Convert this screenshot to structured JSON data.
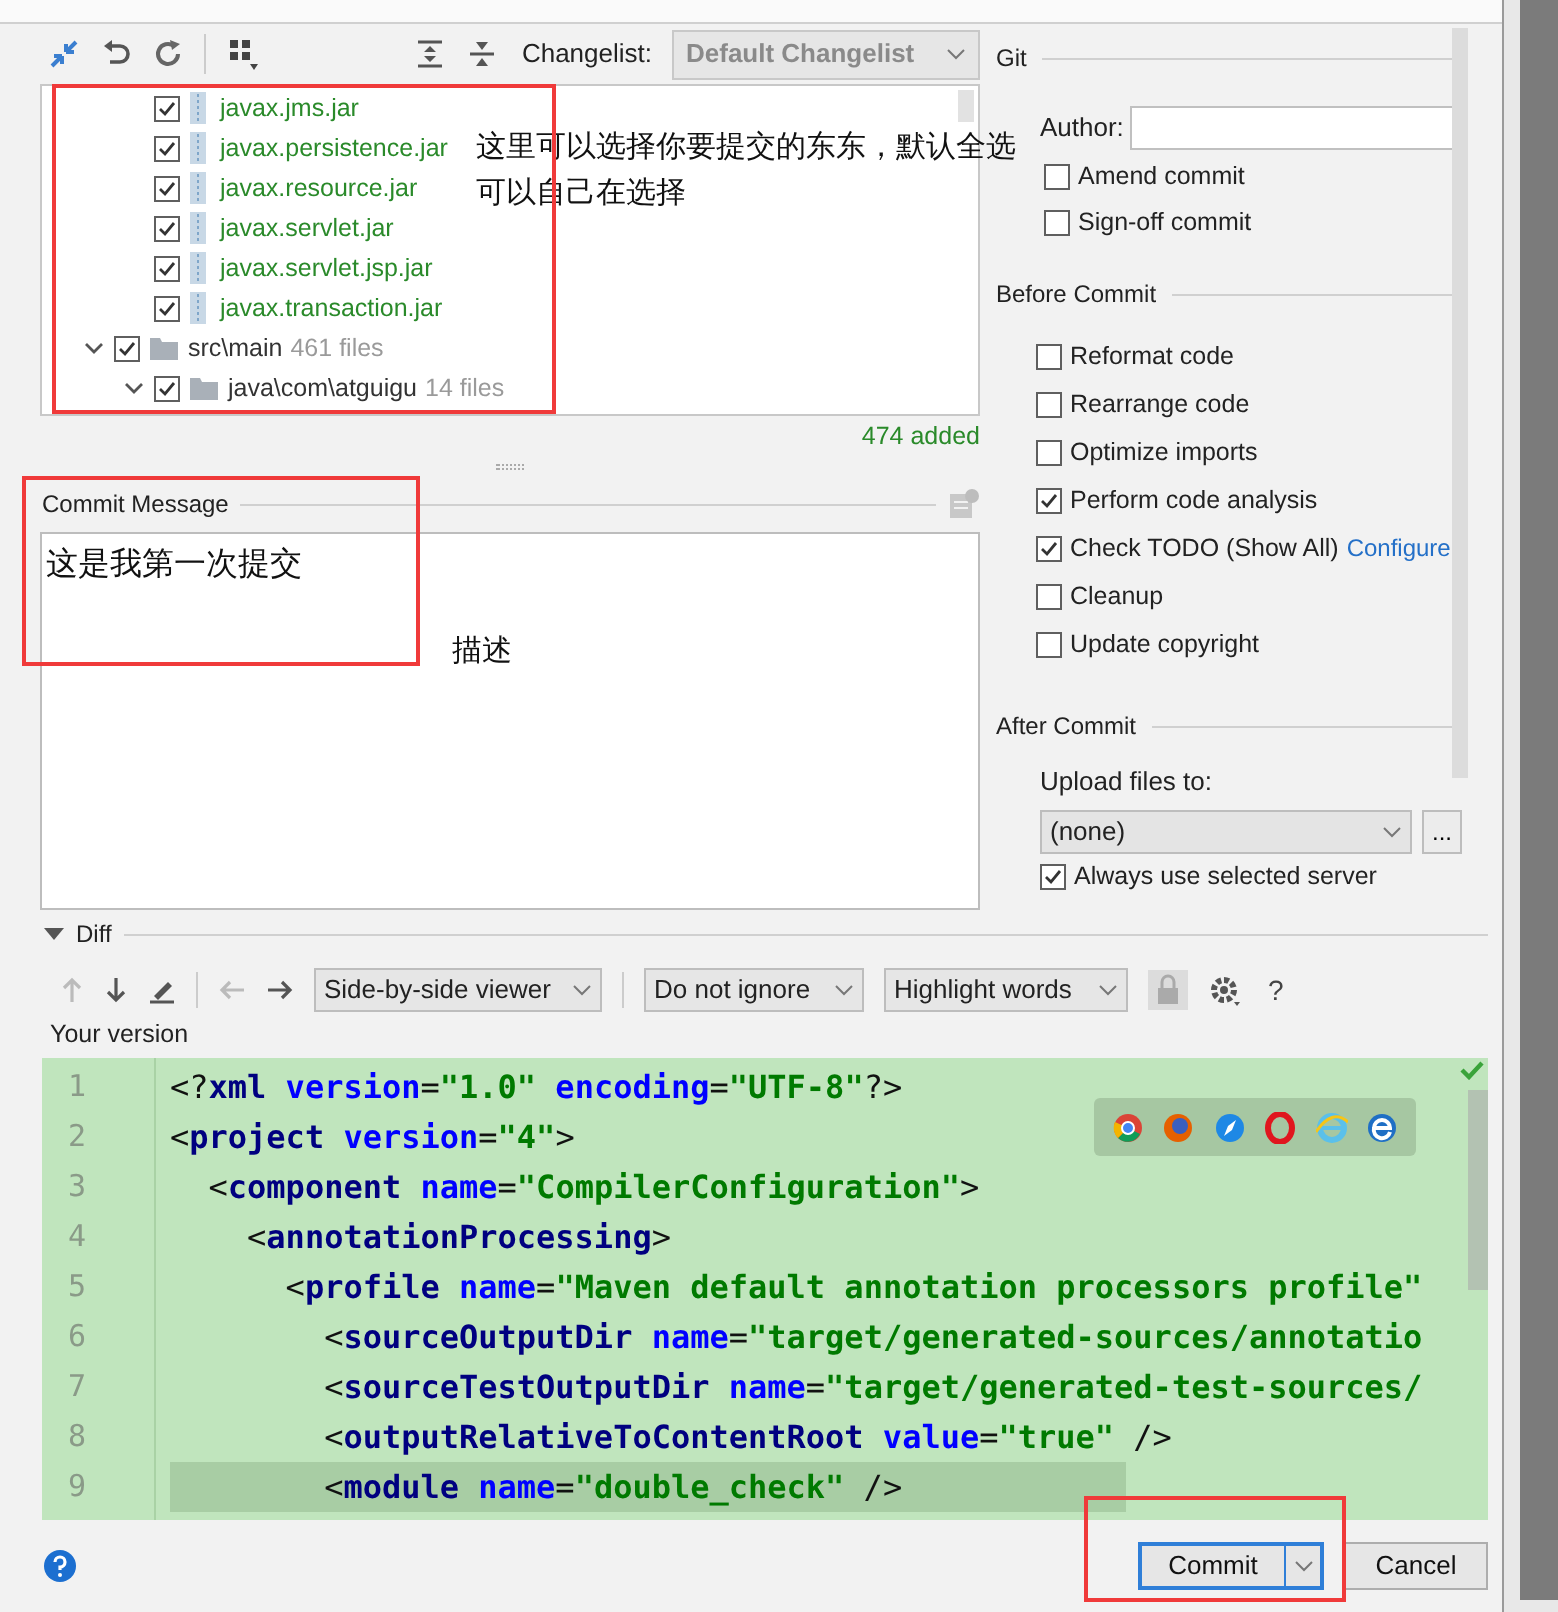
{
  "toolbar": {
    "changelist_label": "Changelist:",
    "changelist": "Default Changelist"
  },
  "file_tree": [
    {
      "kind": "file",
      "name": "javax.jms.jar",
      "checked": true
    },
    {
      "kind": "file",
      "name": "javax.persistence.jar",
      "checked": true
    },
    {
      "kind": "file",
      "name": "javax.resource.jar",
      "checked": true
    },
    {
      "kind": "file",
      "name": "javax.servlet.jar",
      "checked": true
    },
    {
      "kind": "file",
      "name": "javax.servlet.jsp.jar",
      "checked": true
    },
    {
      "kind": "file",
      "name": "javax.transaction.jar",
      "checked": true
    },
    {
      "kind": "folder",
      "name": "src\\main",
      "count": "461 files",
      "checked": true,
      "expanded": true,
      "children": [
        {
          "kind": "folder",
          "name": "java\\com\\atguigu",
          "count": "14 files",
          "checked": true,
          "expanded": true
        }
      ]
    }
  ],
  "summary": "474 added",
  "commit_message": {
    "label": "Commit Message",
    "value": "这是我第一次提交"
  },
  "git": {
    "title": "Git",
    "author_label": "Author:",
    "options": [
      {
        "label": "Amend commit",
        "checked": false
      },
      {
        "label": "Sign-off commit",
        "checked": false
      }
    ]
  },
  "before_commit": {
    "title": "Before Commit",
    "options": [
      {
        "label": "Reformat code",
        "checked": false
      },
      {
        "label": "Rearrange code",
        "checked": false
      },
      {
        "label": "Optimize imports",
        "checked": false
      },
      {
        "label": "Perform code analysis",
        "checked": true
      },
      {
        "label": "Check TODO (Show All)",
        "checked": true,
        "link": "Configure"
      },
      {
        "label": "Cleanup",
        "checked": false
      },
      {
        "label": "Update copyright",
        "checked": false
      }
    ]
  },
  "after_commit": {
    "title": "After Commit",
    "upload_label": "Upload files to:",
    "upload_value": "(none)",
    "more": "...",
    "options": [
      {
        "label": "Always use selected server",
        "checked": true
      }
    ]
  },
  "diff": {
    "title": "Diff",
    "expanded": true,
    "viewer": "Side-by-side viewer",
    "ignore": "Do not ignore",
    "highlight": "Highlight words",
    "help": "?",
    "side_label": "Your version",
    "lines": [
      {
        "number": "1",
        "current": false,
        "tokens": [
          {
            "kind": "punct",
            "text": "<?"
          },
          {
            "kind": "tag",
            "text": "xml"
          },
          {
            "kind": "attr",
            "text": " version"
          },
          {
            "kind": "punct",
            "text": "="
          },
          {
            "kind": "value",
            "text": "\"1.0\""
          },
          {
            "kind": "attr",
            "text": " encoding"
          },
          {
            "kind": "punct",
            "text": "="
          },
          {
            "kind": "value",
            "text": "\"UTF-8\""
          },
          {
            "kind": "punct",
            "text": "?>"
          }
        ]
      },
      {
        "number": "2",
        "current": false,
        "tokens": [
          {
            "kind": "punct",
            "text": "<"
          },
          {
            "kind": "tag",
            "text": "project"
          },
          {
            "kind": "attr",
            "text": " version"
          },
          {
            "kind": "punct",
            "text": "="
          },
          {
            "kind": "value",
            "text": "\"4\""
          },
          {
            "kind": "punct",
            "text": ">"
          }
        ]
      },
      {
        "number": "3",
        "current": false,
        "tokens": [
          {
            "kind": "punct",
            "text": "  <"
          },
          {
            "kind": "tag",
            "text": "component"
          },
          {
            "kind": "attr",
            "text": " name"
          },
          {
            "kind": "punct",
            "text": "="
          },
          {
            "kind": "value",
            "text": "\"CompilerConfiguration\""
          },
          {
            "kind": "punct",
            "text": ">"
          }
        ]
      },
      {
        "number": "4",
        "current": false,
        "tokens": [
          {
            "kind": "punct",
            "text": "    <"
          },
          {
            "kind": "tag",
            "text": "annotationProcessing"
          },
          {
            "kind": "punct",
            "text": ">"
          }
        ]
      },
      {
        "number": "5",
        "current": false,
        "tokens": [
          {
            "kind": "punct",
            "text": "      <"
          },
          {
            "kind": "tag",
            "text": "profile"
          },
          {
            "kind": "attr",
            "text": " name"
          },
          {
            "kind": "punct",
            "text": "="
          },
          {
            "kind": "value",
            "text": "\"Maven default annotation processors profile\""
          }
        ]
      },
      {
        "number": "6",
        "current": false,
        "tokens": [
          {
            "kind": "punct",
            "text": "        <"
          },
          {
            "kind": "tag",
            "text": "sourceOutputDir"
          },
          {
            "kind": "attr",
            "text": " name"
          },
          {
            "kind": "punct",
            "text": "="
          },
          {
            "kind": "value",
            "text": "\"target/generated-sources/annotatio"
          }
        ]
      },
      {
        "number": "7",
        "current": false,
        "tokens": [
          {
            "kind": "punct",
            "text": "        <"
          },
          {
            "kind": "tag",
            "text": "sourceTestOutputDir"
          },
          {
            "kind": "attr",
            "text": " name"
          },
          {
            "kind": "punct",
            "text": "="
          },
          {
            "kind": "value",
            "text": "\"target/generated-test-sources/"
          }
        ]
      },
      {
        "number": "8",
        "current": false,
        "tokens": [
          {
            "kind": "punct",
            "text": "        <"
          },
          {
            "kind": "tag",
            "text": "outputRelativeToContentRoot"
          },
          {
            "kind": "attr",
            "text": " value"
          },
          {
            "kind": "punct",
            "text": "="
          },
          {
            "kind": "value",
            "text": "\"true\""
          },
          {
            "kind": "punct",
            "text": " />"
          }
        ]
      },
      {
        "number": "9",
        "current": true,
        "tokens": [
          {
            "kind": "punct",
            "text": "        <"
          },
          {
            "kind": "tag",
            "text": "module"
          },
          {
            "kind": "attr",
            "text": " name"
          },
          {
            "kind": "punct",
            "text": "="
          },
          {
            "kind": "value",
            "text": "\"double_check\""
          },
          {
            "kind": "punct",
            "text": " />"
          }
        ]
      }
    ]
  },
  "buttons": [
    {
      "kind": "default",
      "label": "Commit"
    },
    {
      "kind": "normal",
      "label": "Cancel"
    }
  ],
  "annotations": [
    {
      "text": "这里可以选择你要提交的东东，默认全选"
    },
    {
      "text": "可以自己在选择"
    },
    {
      "text": "描述"
    }
  ]
}
